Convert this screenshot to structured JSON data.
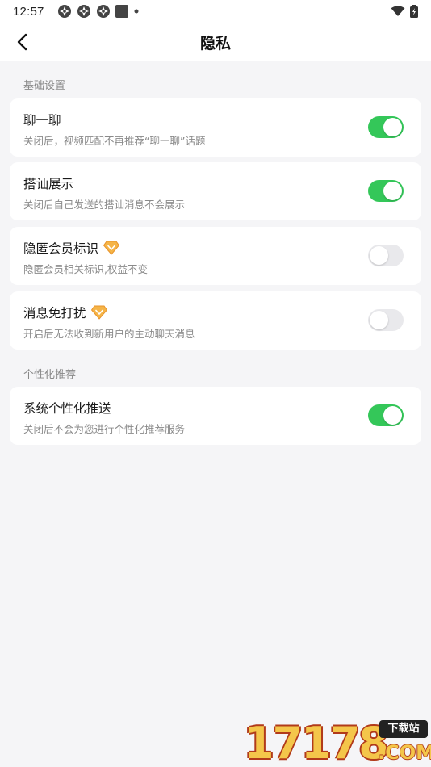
{
  "status_bar": {
    "time": "12:57"
  },
  "header": {
    "title": "隐私"
  },
  "sections": [
    {
      "label": "基础设置",
      "items": [
        {
          "title": "聊一聊",
          "desc": "关闭后，视频匹配不再推荐“聊一聊”话题",
          "toggle": "on",
          "vip": false
        },
        {
          "title": "搭讪展示",
          "desc": "关闭后自己发送的搭讪消息不会展示",
          "toggle": "on",
          "vip": false
        },
        {
          "title": "隐匿会员标识",
          "desc": "隐匿会员相关标识,权益不变",
          "toggle": "off",
          "vip": true
        },
        {
          "title": "消息免打扰",
          "desc": "开启后无法收到新用户的主动聊天消息",
          "toggle": "off",
          "vip": true
        }
      ]
    },
    {
      "label": "个性化推荐",
      "items": [
        {
          "title": "系统个性化推送",
          "desc": "关闭后不会为您进行个性化推荐服务",
          "toggle": "on",
          "vip": false
        }
      ]
    }
  ],
  "watermark": {
    "digits": "17178",
    "tag": "下载站",
    "suffix": ".COM"
  },
  "colors": {
    "toggle_on": "#34c759",
    "toggle_off": "#e9e9ec",
    "background": "#f5f5f7",
    "vip_icon": "#f0a73a"
  },
  "icons": {
    "back": "chevron-left-icon",
    "vip": "diamond-icon",
    "wifi": "wifi-icon",
    "battery": "battery-icon"
  }
}
